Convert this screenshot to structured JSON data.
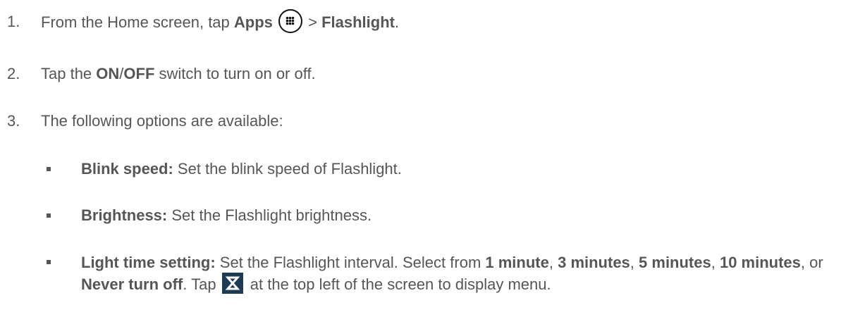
{
  "steps": [
    {
      "number": "1.",
      "text_before": "From the Home screen, tap ",
      "bold1": "Apps",
      "icon": "apps-grid-icon",
      "text_mid": " > ",
      "bold2": "Flashlight",
      "text_after": "."
    },
    {
      "number": "2.",
      "text_before": "Tap the ",
      "bold1": "ON",
      "sep": "/",
      "bold2": "OFF",
      "text_after": " switch to turn on or off."
    },
    {
      "number": "3.",
      "text": "The following options are available:"
    }
  ],
  "options": [
    {
      "label": "Blink speed:",
      "text": " Set the blink speed of Flashlight."
    },
    {
      "label": "Brightness:",
      "text": " Set the Flashlight brightness."
    },
    {
      "label": "Light time setting:",
      "text1": " Set the Flashlight interval. Select from ",
      "choice1": "1 minute",
      "sep1": ", ",
      "choice2": "3 minutes",
      "sep2": ", ",
      "choice3": "5 minutes",
      "sep3": ", ",
      "choice4": "10 minutes",
      "sep4": ", or ",
      "choice5": "Never turn off",
      "text2": ". Tap ",
      "icon": "hourglass-icon",
      "text3": " at the top left of the screen to display menu."
    }
  ],
  "colors": {
    "text": "#565656",
    "hourglass_bg": "#1f3a55"
  }
}
